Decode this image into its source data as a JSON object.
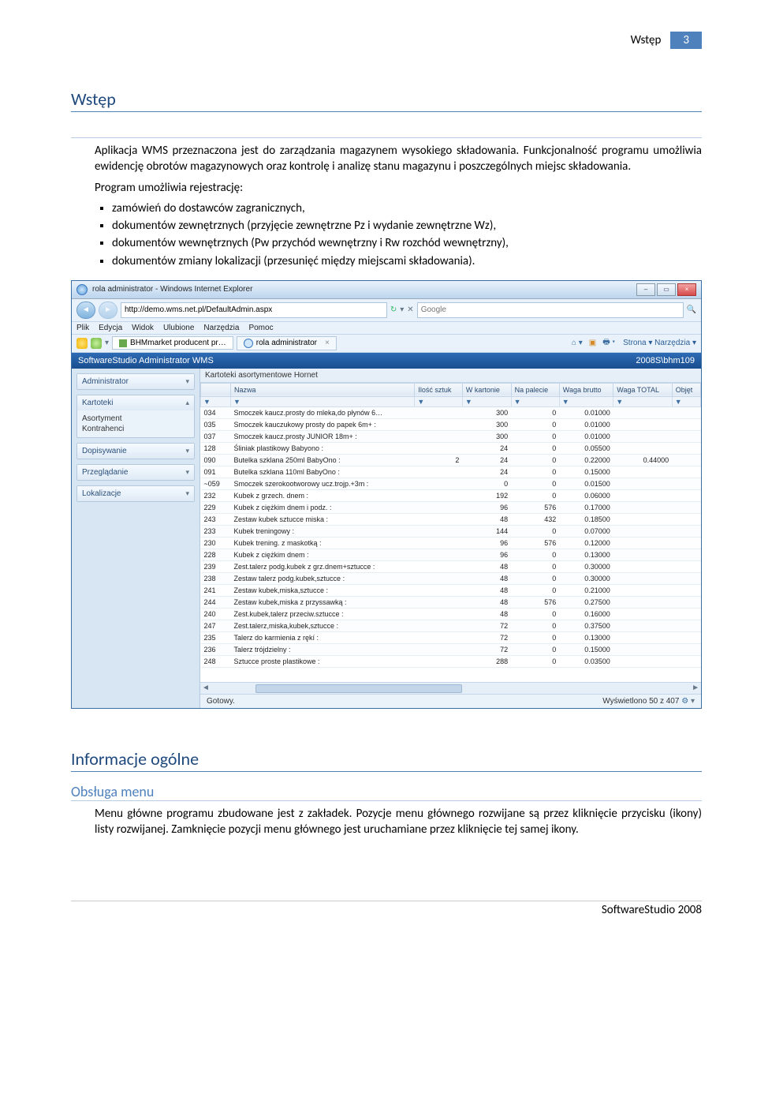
{
  "header": {
    "label": "Wstęp",
    "page": "3"
  },
  "h_wstep": "Wstęp",
  "p1": "Aplikacja WMS przeznaczona jest do zarządzania magazynem wysokiego składowania. Funkcjonalność programu umożliwia ewidencję obrotów magazynowych oraz kontrolę i analizę stanu magazynu i poszczególnych miejsc składowania.",
  "p2": "Program umożliwia rejestrację:",
  "bullets": [
    "zamówień do dostawców zagranicznych,",
    "dokumentów zewnętrznych (przyjęcie zewnętrzne Pz i wydanie zewnętrzne Wz),",
    "dokumentów wewnętrznych (Pw przychód wewnętrzny i Rw rozchód wewnętrzny),",
    "dokumentów zmiany lokalizacji (przesunięć między miejscami składowania)."
  ],
  "h_info": "Informacje ogólne",
  "h_menu": "Obsługa menu",
  "p3": "Menu główne programu zbudowane jest z zakładek. Pozycje menu głównego rozwijane są przez kliknięcie przycisku (ikony) listy rozwijanej. Zamknięcie pozycji menu głównego jest uruchamiane przez kliknięcie tej samej ikony.",
  "footer": "SoftwareStudio 2008",
  "app": {
    "wintitle": "rola administrator - Windows Internet Explorer",
    "url": "http://demo.wms.net.pl/DefaultAdmin.aspx",
    "search_placeholder": "Google",
    "menubar": [
      "Plik",
      "Edycja",
      "Widok",
      "Ulubione",
      "Narzędzia",
      "Pomoc"
    ],
    "tabs": [
      "BHMmarket producent pr…",
      "rola administrator"
    ],
    "rtools": "Strona ▾   Narzędzia ▾",
    "swtitle": "SoftwareStudio Administrator WMS",
    "swuser": "2008S\\bhm109",
    "accordion": [
      {
        "title": "Administrator",
        "open": false
      },
      {
        "title": "Kartoteki",
        "open": true,
        "items": [
          "Asortyment",
          "Kontrahenci"
        ]
      },
      {
        "title": "Dopisywanie",
        "open": false
      },
      {
        "title": "Przeglądanie",
        "open": false
      },
      {
        "title": "Lokalizacje",
        "open": false
      }
    ],
    "gridtitle": "Kartoteki asortymentowe Hornet",
    "columns": [
      "",
      "Nazwa",
      "Ilość sztuk",
      "W kartonie",
      "Na palecie",
      "Waga brutto",
      "Waga TOTAL",
      "Objęt"
    ],
    "rows": [
      [
        "034",
        "Smoczek kaucz.prosty do mleka,do płynów 6…",
        "",
        "300",
        "0",
        "0.01000",
        "",
        ""
      ],
      [
        "035",
        "Smoczek kauczukowy prosty do papek 6m+ :",
        "",
        "300",
        "0",
        "0.01000",
        "",
        ""
      ],
      [
        "037",
        "Smoczek kaucz.prosty JUNIOR 18m+ :",
        "",
        "300",
        "0",
        "0.01000",
        "",
        ""
      ],
      [
        "128",
        "Śliniak plastikowy Babyono :",
        "",
        "24",
        "0",
        "0.05500",
        "",
        ""
      ],
      [
        "090",
        "Butelka szklana 250ml BabyOno :",
        "2",
        "24",
        "0",
        "0.22000",
        "0.44000",
        ""
      ],
      [
        "091",
        "Butelka szklana 110ml BabyOno :",
        "",
        "24",
        "0",
        "0.15000",
        "",
        ""
      ],
      [
        "~059",
        "Smoczek szerokootworowy ucz.trojp.+3m :",
        "",
        "0",
        "0",
        "0.01500",
        "",
        ""
      ],
      [
        "232",
        "Kubek z grzech. dnem :",
        "",
        "192",
        "0",
        "0.06000",
        "",
        ""
      ],
      [
        "229",
        "Kubek z ciężkim dnem i podz. :",
        "",
        "96",
        "576",
        "0.17000",
        "",
        ""
      ],
      [
        "243",
        "Zestaw kubek sztucce miska :",
        "",
        "48",
        "432",
        "0.18500",
        "",
        ""
      ],
      [
        "233",
        "Kubek treningowy :",
        "",
        "144",
        "0",
        "0.07000",
        "",
        ""
      ],
      [
        "230",
        "Kubek trening. z maskotką :",
        "",
        "96",
        "576",
        "0.12000",
        "",
        ""
      ],
      [
        "228",
        "Kubek z ciężkim dnem :",
        "",
        "96",
        "0",
        "0.13000",
        "",
        ""
      ],
      [
        "239",
        "Zest.talerz podg.kubek z grz.dnem+sztucce :",
        "",
        "48",
        "0",
        "0.30000",
        "",
        ""
      ],
      [
        "238",
        "Zestaw talerz podg.kubek,sztucce :",
        "",
        "48",
        "0",
        "0.30000",
        "",
        ""
      ],
      [
        "241",
        "Zestaw kubek,miska,sztucce :",
        "",
        "48",
        "0",
        "0.21000",
        "",
        ""
      ],
      [
        "244",
        "Zestaw kubek,miska z przyssawką :",
        "",
        "48",
        "576",
        "0.27500",
        "",
        ""
      ],
      [
        "240",
        "Zest.kubek,talerz przeciw.sztucce :",
        "",
        "48",
        "0",
        "0.16000",
        "",
        ""
      ],
      [
        "247",
        "Zest.talerz,miska,kubek,sztucce :",
        "",
        "72",
        "0",
        "0.37500",
        "",
        ""
      ],
      [
        "235",
        "Talerz do karmienia z rękí :",
        "",
        "72",
        "0",
        "0.13000",
        "",
        ""
      ],
      [
        "236",
        "Talerz trójdzielny :",
        "",
        "72",
        "0",
        "0.15000",
        "",
        ""
      ],
      [
        "248",
        "Sztucce proste plastikowe :",
        "",
        "288",
        "0",
        "0.03500",
        "",
        ""
      ]
    ],
    "status_left": "Gotowy.",
    "status_right": "Wyświetlono 50 z 407"
  }
}
